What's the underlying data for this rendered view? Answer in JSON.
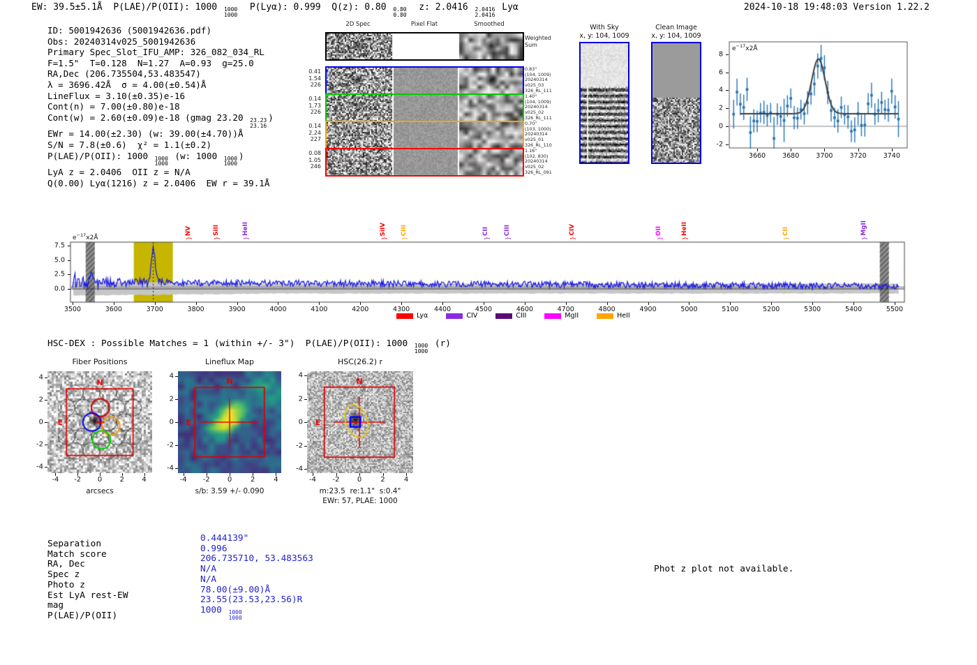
{
  "header": {
    "left_tokens": [
      {
        "t": "x",
        "v": "EW: 39.5±5.1Å  P(LAE)/P(OII): 1000 "
      },
      {
        "t": "f",
        "top": "1000",
        "bottom": "1000"
      },
      {
        "t": "x",
        "v": "  P(Lyα): 0.999  Q(z): 0.80 "
      },
      {
        "t": "f",
        "top": "0.80",
        "bottom": "0.80"
      },
      {
        "t": "x",
        "v": "  z: 2.0416 "
      },
      {
        "t": "f",
        "top": "2.0416",
        "bottom": "2.0416"
      },
      {
        "t": "x",
        "v": " Lyα"
      }
    ],
    "timestamp": "2024-10-18 19:48:03",
    "version": "Version 1.22.2"
  },
  "info": {
    "lines": [
      [
        {
          "t": "x",
          "v": "ID: 5001942636 (5001942636.pdf)"
        }
      ],
      [
        {
          "t": "x",
          "v": "Obs: 20240314v025_5001942636"
        }
      ],
      [
        {
          "t": "x",
          "v": "Primary Spec_Slot_IFU_AMP: 326_082_034_RL"
        }
      ],
      [
        {
          "t": "x",
          "v": "F=1.5\"  T=0.128  N=1.27  A=0.93  g=25.0"
        }
      ],
      [
        {
          "t": "x",
          "v": "RA,Dec (206.735504,53.483547)"
        }
      ],
      [
        {
          "t": "x",
          "v": "λ = 3696.42Å  σ = 4.00(±0.54)Å"
        }
      ],
      [
        {
          "t": "x",
          "v": "LineFlux = 3.10(±0.35)e-16"
        }
      ],
      [
        {
          "t": "x",
          "v": "Cont(n) = 7.00(±0.80)e-18"
        }
      ],
      [
        {
          "t": "x",
          "v": "Cont(w) = 2.60(±0.09)e-18 (gmag 23.20 "
        },
        {
          "t": "f",
          "top": "23.23",
          "bottom": "23.16"
        },
        {
          "t": "x",
          "v": ")"
        }
      ],
      [
        {
          "t": "x",
          "v": "EWr = 14.00(±2.30) (w: 39.00(±4.70))Å"
        }
      ],
      [
        {
          "t": "x",
          "v": "S/N = 7.8(±0.6)  χ² = 1.1(±0.2)"
        }
      ],
      [
        {
          "t": "x",
          "v": "P(LAE)/P(OII): 1000 "
        },
        {
          "t": "f",
          "top": "1000",
          "bottom": "1000"
        },
        {
          "t": "x",
          "v": " (w: 1000 "
        },
        {
          "t": "f",
          "top": "1000",
          "bottom": "1000"
        },
        {
          "t": "x",
          "v": ")"
        }
      ],
      [
        {
          "t": "x",
          "v": "LyA z = 2.0406  OII z = N/A"
        }
      ],
      [
        {
          "t": "x",
          "v": "Q(0.00) Lyα(1216) z = 2.0406  EW r = 39.1Å"
        }
      ]
    ]
  },
  "montage": {
    "col_headers": [
      "2D Spec",
      "Pixel Flat",
      "Smoothed"
    ],
    "weighted_label": [
      "Weighted",
      "Sum"
    ],
    "rows": [
      {
        "border": "#000000",
        "left": [],
        "right": [],
        "blob": 0.7,
        "flat": "white"
      },
      {
        "border": "#0000ff",
        "left": [
          "0.41",
          "1.54",
          "226"
        ],
        "right": [
          "0.83\"",
          "(104, 1009)",
          "20240314",
          "v025_03",
          "326_RL_111"
        ],
        "blob": 0.75,
        "flat": "gray"
      },
      {
        "border": "#00cc00",
        "left": [
          "0.14",
          "1.73",
          "226"
        ],
        "right": [
          "1.40\"",
          "(104, 1009)",
          "20240314",
          "v025_02",
          "326_RL_111"
        ],
        "blob": 0.35,
        "flat": "gray"
      },
      {
        "border": "#ffa500",
        "left": [
          "0.14",
          "2.24",
          "227"
        ],
        "right": [
          "0.70\"",
          "(103, 1000)",
          "20240314",
          "v025_01",
          "326_RL_110"
        ],
        "blob": 0.0,
        "flat": "gray"
      },
      {
        "border": "#ff0000",
        "left": [
          "0.08",
          "1.05",
          "246"
        ],
        "right": [
          "1.16\"",
          "(102, 830)",
          "20240314",
          "v025_02",
          "326_RL_091"
        ],
        "blob": 0.0,
        "flat": "gray"
      }
    ]
  },
  "sky_panels": {
    "border_color": "#0000dd",
    "withsky": {
      "title1": "With Sky",
      "title2": "x, y: 104, 1009"
    },
    "clean": {
      "title1": "Clean Image",
      "title2": "x, y: 104, 1009"
    }
  },
  "hscdex": {
    "tokens": [
      {
        "t": "x",
        "v": "HSC-DEX : Possible Matches = 1 (within +/- 3\")  P(LAE)/P(OII): 1000 "
      },
      {
        "t": "f",
        "top": "1000",
        "bottom": "1000"
      },
      {
        "t": "x",
        "v": " (r)"
      }
    ]
  },
  "match_table": {
    "labels": [
      "Separation",
      "Match score",
      "RA, Dec",
      "Spec z",
      "Photo z",
      "Est LyA rest-EW",
      "mag",
      "P(LAE)/P(OII)"
    ],
    "values": [
      [
        {
          "t": "x",
          "v": "0.444139\""
        }
      ],
      [
        {
          "t": "x",
          "v": "0.996"
        }
      ],
      [
        {
          "t": "x",
          "v": "206.735710, 53.483563"
        }
      ],
      [
        {
          "t": "x",
          "v": "N/A"
        }
      ],
      [
        {
          "t": "x",
          "v": "N/A"
        }
      ],
      [
        {
          "t": "x",
          "v": "78.00(±9.00)Å"
        }
      ],
      [
        {
          "t": "x",
          "v": "23.55(23.53,23.56)R"
        }
      ],
      [
        {
          "t": "x",
          "v": "1000 "
        },
        {
          "t": "f",
          "top": "1000",
          "bottom": "1000"
        }
      ]
    ]
  },
  "photz_note": "Phot z plot not available.",
  "chart_data": [
    {
      "id": "line_fit",
      "type": "scatter",
      "units_label": {
        "prefix": "e",
        "sup": "−17",
        "suffix": "x2Å"
      },
      "x_start": 3646,
      "x_step": 2,
      "y": [
        1.35,
        3.8,
        2.45,
        2.1,
        4.1,
        -0.7,
        0.6,
        0.55,
        1.5,
        1.55,
        1.2,
        1.5,
        -1.35,
        1.35,
        1.1,
        0.65,
        2.25,
        3.1,
        0.95,
        0.9,
        1.85,
        1.4,
        2.6,
        3.6,
        4.7,
        6.7,
        7.55,
        6.5,
        3.75,
        1.75,
        0.95,
        0.6,
        2.1,
        1.3,
        1.05,
        -0.55,
        -0.4,
        1.4,
        0.1,
        0.15,
        2.5,
        3.45,
        1.35,
        1.75,
        2.65,
        1.85,
        1.8,
        3.9,
        2.15,
        0.8
      ],
      "yerr": [
        1.6,
        1.5,
        1.2,
        1.4,
        1.3,
        1.8,
        1.3,
        1.2,
        1.1,
        1.3,
        1.2,
        1.1,
        2.4,
        1.2,
        1.1,
        2.4,
        1.2,
        1.1,
        1.3,
        1.2,
        1.1,
        1.2,
        1.3,
        1.2,
        1.3,
        1.4,
        1.5,
        1.4,
        1.3,
        1.2,
        1.1,
        1.3,
        1.2,
        1.1,
        1.3,
        1.2,
        1.4,
        1.3,
        1.2,
        1.3,
        1.2,
        1.4,
        1.2,
        1.3,
        1.2,
        1.1,
        1.3,
        1.4,
        1.3,
        2.0
      ],
      "fit": {
        "shape": "gaussian",
        "center": 3696.42,
        "sigma": 4.0,
        "amplitude": 6.1,
        "baseline": 1.4
      },
      "xticks": [
        3660,
        3680,
        3700,
        3720,
        3740
      ],
      "yticks": [
        8,
        6,
        4,
        2,
        0,
        -2
      ],
      "colors": {
        "points": "#2372b5",
        "fit": "#3c3c3c"
      }
    },
    {
      "id": "main_spectrum",
      "type": "line",
      "units_label": {
        "prefix": "e",
        "sup": "−17",
        "suffix": "x2Å"
      },
      "xlim": [
        3495,
        5523
      ],
      "xticks": [
        3500,
        3600,
        3700,
        3800,
        3900,
        4000,
        4100,
        4200,
        4300,
        4400,
        4500,
        4600,
        4700,
        4800,
        4900,
        5000,
        5100,
        5200,
        5300,
        5400,
        5500
      ],
      "yticks": [
        "7.5",
        "5.0",
        "2.5",
        "0.0"
      ],
      "ytick_vals": [
        7.5,
        5.0,
        2.5,
        0.0
      ],
      "continuum": {
        "start": 1.15,
        "end": 0.5
      },
      "noise_sigma": 0.55,
      "peak": {
        "center": 3696.42,
        "sigma": 4.3,
        "amplitude": 6.4
      },
      "seed": 1337,
      "line_color": "#1212e6",
      "band": {
        "color": "#c6c6c6",
        "center_line": "#8f8f8f"
      },
      "highlight": {
        "from": 3649,
        "to": 3744,
        "color": "#c6b600"
      },
      "masked": [
        [
          3532,
          3554
        ],
        [
          5464,
          5486
        ]
      ],
      "dotted_line": 3696.42,
      "markers": [
        {
          "name": "NV",
          "wave": 3782,
          "color": "#ff0000"
        },
        {
          "name": "SiII",
          "wave": 3849,
          "color": "#ff0000"
        },
        {
          "name": "HeII",
          "wave": 3921,
          "color": "#8a2be2"
        },
        {
          "name": "SiIV",
          "wave": 4256,
          "color": "#ff0000"
        },
        {
          "name": "CIII",
          "wave": 4306,
          "color": "#ffa500"
        },
        {
          "name": "CII",
          "wave": 4506,
          "color": "#8a2be2"
        },
        {
          "name": "CIII",
          "wave": 4558,
          "color": "#8a2be2"
        },
        {
          "name": "CIV",
          "wave": 4715,
          "color": "#ff0000"
        },
        {
          "name": "OII",
          "wave": 4927,
          "color": "#ff00ff"
        },
        {
          "name": "HeII",
          "wave": 4989,
          "color": "#ff0000"
        },
        {
          "name": "CII",
          "wave": 5235,
          "color": "#ffa500"
        },
        {
          "name": "MgII",
          "wave": 5425,
          "color": "#8a2be2"
        }
      ],
      "legend": [
        {
          "label": "Lyα",
          "color": "#ff0000"
        },
        {
          "label": "CIV",
          "color": "#8a2be2"
        },
        {
          "label": "CIII",
          "color": "#5c0a78"
        },
        {
          "label": "MgII",
          "color": "#ff00ff"
        },
        {
          "label": "HeII",
          "color": "#ffa500"
        }
      ]
    },
    {
      "id": "fiber_positions",
      "type": "heatmap",
      "title": "Fiber Positions",
      "xlabel": "arcsecs",
      "xticks": [
        -4,
        -2,
        0,
        2,
        4
      ],
      "yticks": [
        -4,
        -2,
        0,
        2,
        4
      ],
      "compass": {
        "n": "N",
        "e": "E"
      },
      "box_range": [
        -3,
        3
      ],
      "fibers": {
        "radius": 0.75,
        "highlight": [
          {
            "color": "#e00000",
            "x": 0.05,
            "y": 1.3
          },
          {
            "color": "#0000ff",
            "x": -0.7,
            "y": 0.0
          },
          {
            "color": "#ff9500",
            "x": 1.0,
            "y": -0.35
          },
          {
            "color": "#00d000",
            "x": 0.15,
            "y": -1.6
          }
        ]
      }
    },
    {
      "id": "lineflux_map",
      "type": "heatmap",
      "title": "Lineflux Map",
      "xlabel": "s/b: 3.59 +/- 0.090",
      "xticks": [
        -4,
        -2,
        0,
        2,
        4
      ],
      "yticks": [
        -4,
        -2,
        0,
        2,
        4
      ],
      "compass": {
        "n": "N",
        "e": "E"
      },
      "box_range": [
        -3,
        3
      ],
      "colormap": "viridis"
    },
    {
      "id": "hsc_r",
      "type": "heatmap",
      "title": "HSC(26.2) r",
      "xlabel": "m:23.5  re:1.1\"  s:0.4\"",
      "xlabel2": "EWr: 57, PLAE: 1000",
      "xticks": [
        -4,
        -2,
        0,
        2,
        4
      ],
      "yticks": [
        -4,
        -2,
        0,
        2,
        4
      ],
      "compass": {
        "n": "N",
        "e": "E"
      },
      "box_range": [
        -3,
        3
      ],
      "ellipse": {
        "color": "#e3c61c",
        "cx": -0.25,
        "cy": 0.1,
        "rx": 0.92,
        "ry": 1.45,
        "rot_deg": -20
      },
      "square": {
        "color": "#0000ff",
        "cx": -0.35,
        "cy": 0.02,
        "size": 0.85
      }
    }
  ]
}
